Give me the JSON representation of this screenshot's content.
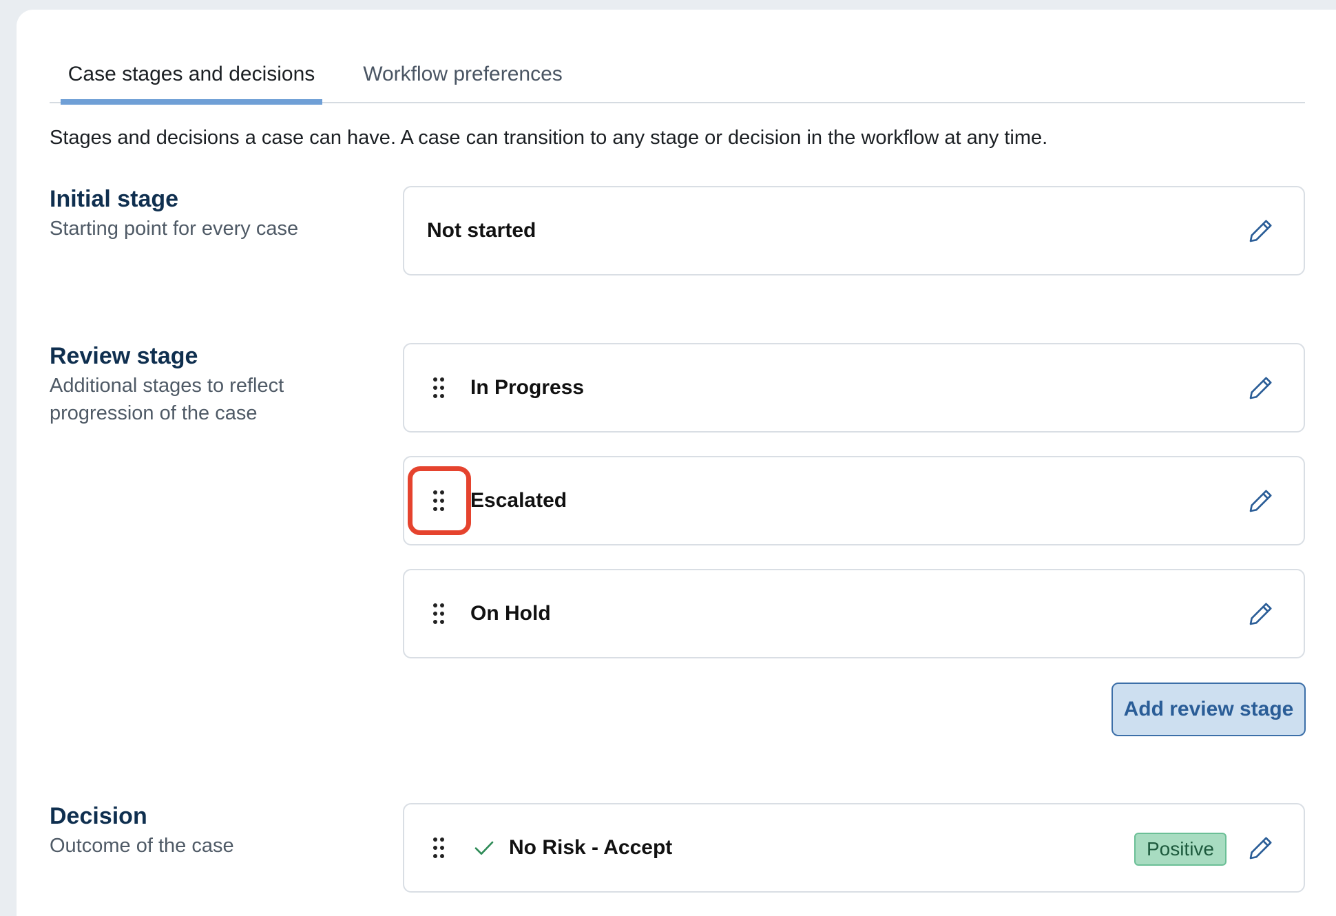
{
  "tabs": [
    {
      "label": "Case stages and decisions",
      "active": true
    },
    {
      "label": "Workflow preferences",
      "active": false
    }
  ],
  "intro": "Stages and decisions a case can have. A case can transition to any stage or decision in the workflow at any time.",
  "initial": {
    "title": "Initial stage",
    "desc": "Starting point for every case",
    "stage": "Not started"
  },
  "review": {
    "title": "Review stage",
    "desc_line1": "Additional stages to reflect",
    "desc_line2": "progression of the case",
    "stages": [
      "In Progress",
      "Escalated",
      "On Hold"
    ],
    "add_label": "Add review stage"
  },
  "decision": {
    "title": "Decision",
    "desc": "Outcome of the case",
    "items": [
      {
        "label": "No Risk - Accept",
        "badge": "Positive",
        "icon": "check-icon"
      }
    ]
  },
  "colors": {
    "accent": "#6f9fd6",
    "heading": "#0f2f4f",
    "positive_badge": "#a8dcc1",
    "highlight": "#e5432e"
  }
}
